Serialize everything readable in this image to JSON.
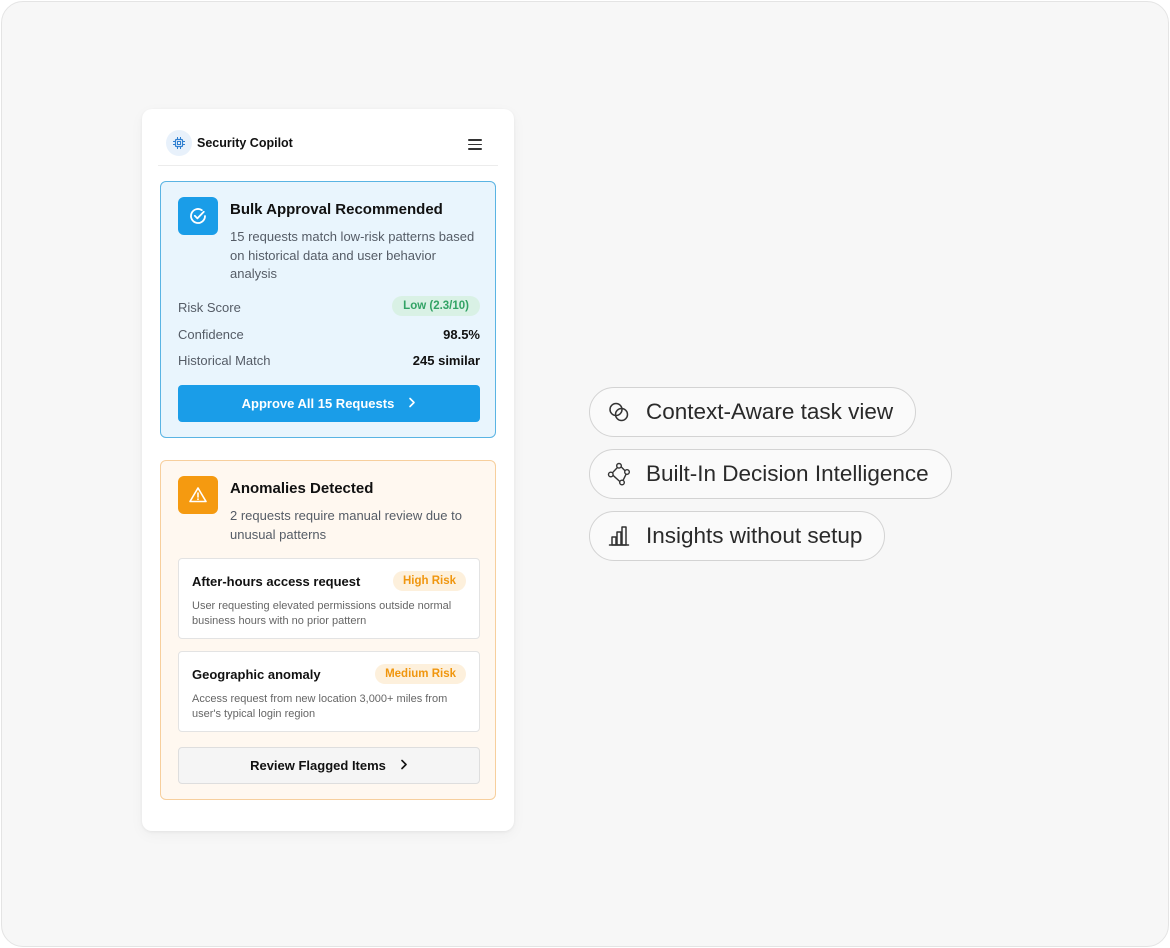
{
  "app": {
    "title": "Security Copilot",
    "icons": {
      "brand": "chip-icon",
      "menu": "hamburger-menu-icon"
    }
  },
  "bulk_approval": {
    "title": "Bulk Approval Recommended",
    "description": "15 requests match low-risk patterns based on historical data and user behavior analysis",
    "icon": "check-circle-icon",
    "accent_color": "#1a9de8",
    "metrics": {
      "risk_score": {
        "label": "Risk Score",
        "value": "Low (2.3/10)"
      },
      "confidence": {
        "label": "Confidence",
        "value": "98.5%"
      },
      "historical_match": {
        "label": "Historical Match",
        "value": "245 similar"
      }
    },
    "action_label": "Approve All 15 Requests"
  },
  "anomalies": {
    "title": "Anomalies Detected",
    "description": "2 requests require manual review due to unusual patterns",
    "icon": "warning-triangle-icon",
    "accent_color": "#f59a10",
    "items": [
      {
        "title": "After-hours access request",
        "risk": "High Risk",
        "description": "User requesting elevated permissions outside normal business hours with no prior pattern"
      },
      {
        "title": "Geographic anomaly",
        "risk": "Medium Risk",
        "description": "Access request from new location 3,000+ miles from user's typical login region"
      }
    ],
    "action_label": "Review Flagged Items"
  },
  "features": [
    {
      "label": "Context-Aware task view",
      "icon": "overlapping-circles-icon"
    },
    {
      "label": "Built-In Decision Intelligence",
      "icon": "network-nodes-icon"
    },
    {
      "label": "Insights without setup",
      "icon": "bar-chart-icon"
    }
  ]
}
